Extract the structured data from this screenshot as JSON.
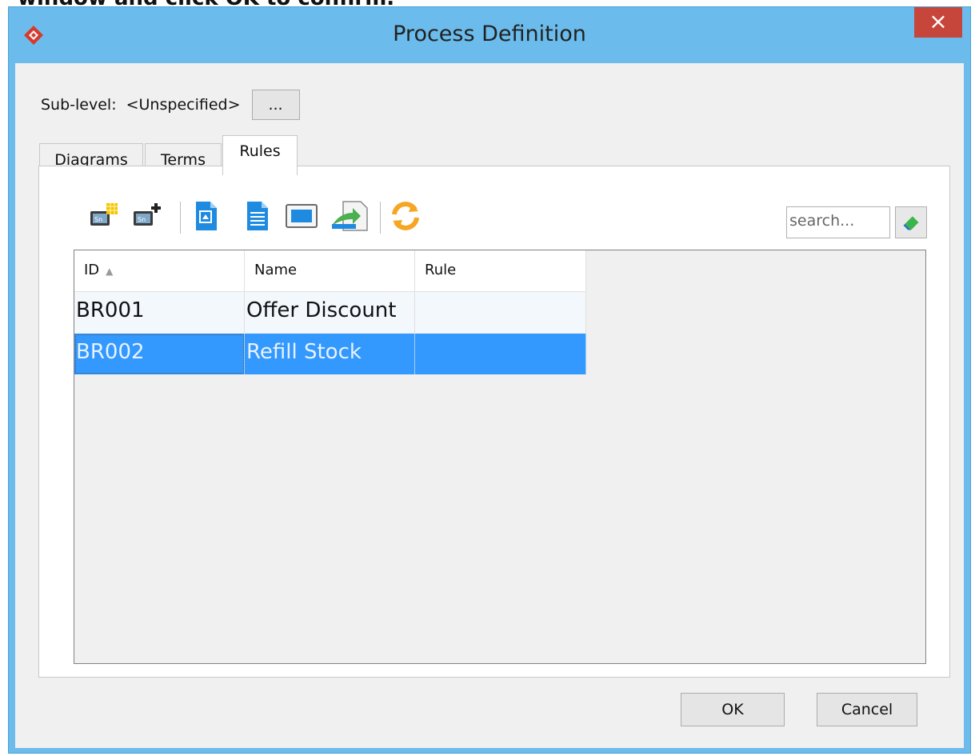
{
  "caption": {
    "text": "window and click OK to confirm."
  },
  "window": {
    "title": "Process Definition",
    "close_glyph": "×",
    "app_icon": "diamond-logo-icon"
  },
  "sublevel": {
    "label": "Sub-level:",
    "value": "<Unspecified>",
    "browse_label": "..."
  },
  "tabs": [
    {
      "label": "Diagrams",
      "active": false
    },
    {
      "label": "Terms",
      "active": false
    },
    {
      "label": "Rules",
      "active": true
    }
  ],
  "toolbar": {
    "icons": [
      "new-rule-icon",
      "add-rule-icon",
      "import-icon",
      "document-icon",
      "frame-icon",
      "export-icon",
      "refresh-icon"
    ]
  },
  "search": {
    "placeholder": "search...",
    "clear_icon": "eraser-icon"
  },
  "table": {
    "columns": [
      "ID",
      "Name",
      "Rule"
    ],
    "sort_indicator": "▲",
    "rows": [
      {
        "id": "BR001",
        "name": "Offer Discount",
        "rule": "",
        "selected": false
      },
      {
        "id": "BR002",
        "name": "Refill Stock",
        "rule": "",
        "selected": true
      }
    ]
  },
  "buttons": {
    "ok": "OK",
    "cancel": "Cancel"
  },
  "colors": {
    "titlebar": "#6bbcec",
    "close": "#c7463c",
    "selection": "#3399ff"
  }
}
